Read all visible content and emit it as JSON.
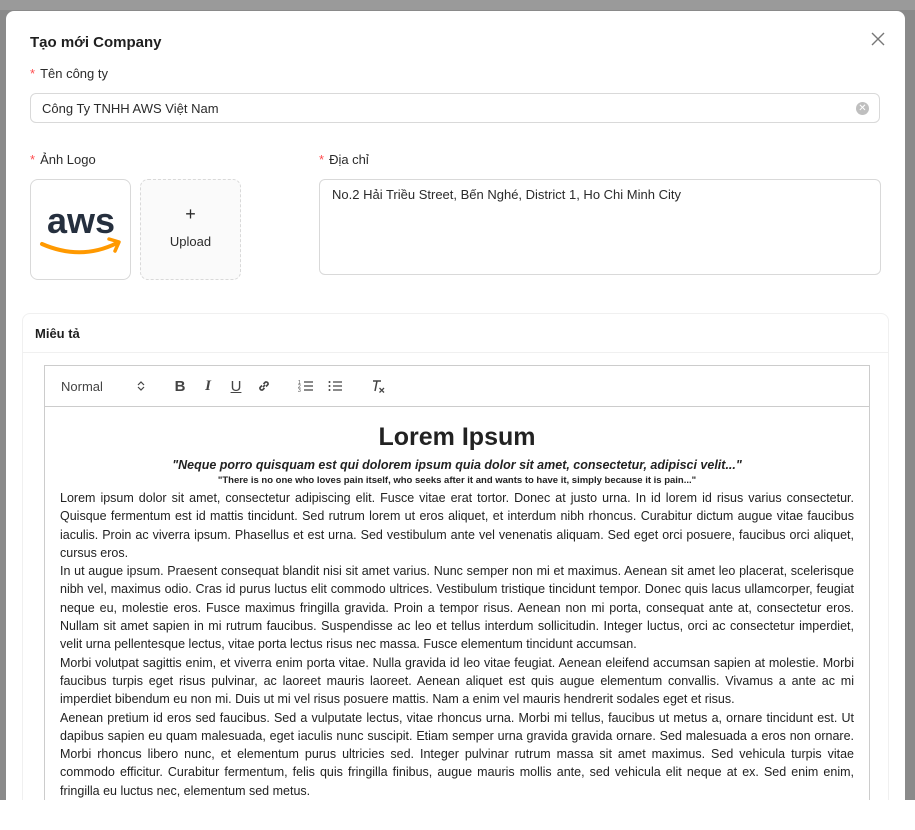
{
  "modal": {
    "title": "Tạo mới Company",
    "close_icon": "close-icon"
  },
  "form": {
    "company_name": {
      "label": "Tên công ty",
      "value": "Công Ty TNHH AWS Việt Nam"
    },
    "logo": {
      "label": "Ảnh Logo",
      "upload_label": "Upload",
      "upload_icon": "+",
      "logo_text": "aws"
    },
    "address": {
      "label": "Địa chỉ",
      "value": "No.2 Hải Triều Street, Bến Nghé, District 1, Ho Chi Minh City"
    },
    "required_mark": "*"
  },
  "description": {
    "label": "Miêu tả",
    "toolbar": {
      "format_select": "Normal",
      "bold": "B",
      "italic": "I",
      "underline": "U",
      "clear_format": "Tx"
    },
    "content": {
      "heading": "Lorem Ipsum",
      "quote": "\"Neque porro quisquam est qui dolorem ipsum quia dolor sit amet, consectetur, adipisci velit...\"",
      "quote_translation": "\"There is no one who loves pain itself, who seeks after it and wants to have it, simply because it is pain...\"",
      "paragraphs": [
        "Lorem ipsum dolor sit amet, consectetur adipiscing elit. Fusce vitae erat tortor. Donec at justo urna. In id lorem id risus varius consectetur. Quisque fermentum est id mattis tincidunt. Sed rutrum lorem ut eros aliquet, et interdum nibh rhoncus. Curabitur dictum augue vitae faucibus iaculis. Proin ac viverra ipsum. Phasellus et est urna. Sed vestibulum ante vel venenatis aliquam. Sed eget orci posuere, faucibus orci aliquet, cursus eros.",
        "In ut augue ipsum. Praesent consequat blandit nisi sit amet varius. Nunc semper non mi et maximus. Aenean sit amet leo placerat, scelerisque nibh vel, maximus odio. Cras id purus luctus elit commodo ultrices. Vestibulum tristique tincidunt tempor. Donec quis lacus ullamcorper, feugiat neque eu, molestie eros. Fusce maximus fringilla gravida. Proin a tempor risus. Aenean non mi porta, consequat ante at, consectetur eros. Nullam sit amet sapien in mi rutrum faucibus. Suspendisse ac leo et tellus interdum sollicitudin. Integer luctus, orci ac consectetur imperdiet, velit urna pellentesque lectus, vitae porta lectus risus nec massa. Fusce elementum tincidunt accumsan.",
        "Morbi volutpat sagittis enim, et viverra enim porta vitae. Nulla gravida id leo vitae feugiat. Aenean eleifend accumsan sapien at molestie. Morbi faucibus turpis eget risus pulvinar, ac laoreet mauris laoreet. Aenean aliquet est quis augue elementum convallis. Vivamus a ante ac mi imperdiet bibendum eu non mi. Duis ut mi vel risus posuere mattis. Nam a enim vel mauris hendrerit sodales eget et risus.",
        "Aenean pretium id eros sed faucibus. Sed a vulputate lectus, vitae rhoncus urna. Morbi mi tellus, faucibus ut metus a, ornare tincidunt est. Ut dapibus sapien eu quam malesuada, eget iaculis nunc suscipit. Etiam semper urna gravida gravida ornare. Sed malesuada a eros non ornare. Morbi rhoncus libero nunc, et elementum purus ultricies sed. Integer pulvinar rutrum massa sit amet maximus. Sed vehicula turpis vitae commodo efficitur. Curabitur fermentum, felis quis fringilla finibus, augue mauris mollis ante, sed vehicula elit neque at ex. Sed enim enim, fringilla eu luctus nec, elementum sed metus."
      ]
    }
  },
  "colors": {
    "required": "#ff4d4f",
    "border": "#d9d9d9",
    "aws_orange": "#ff9900",
    "aws_text": "#252f3e"
  }
}
